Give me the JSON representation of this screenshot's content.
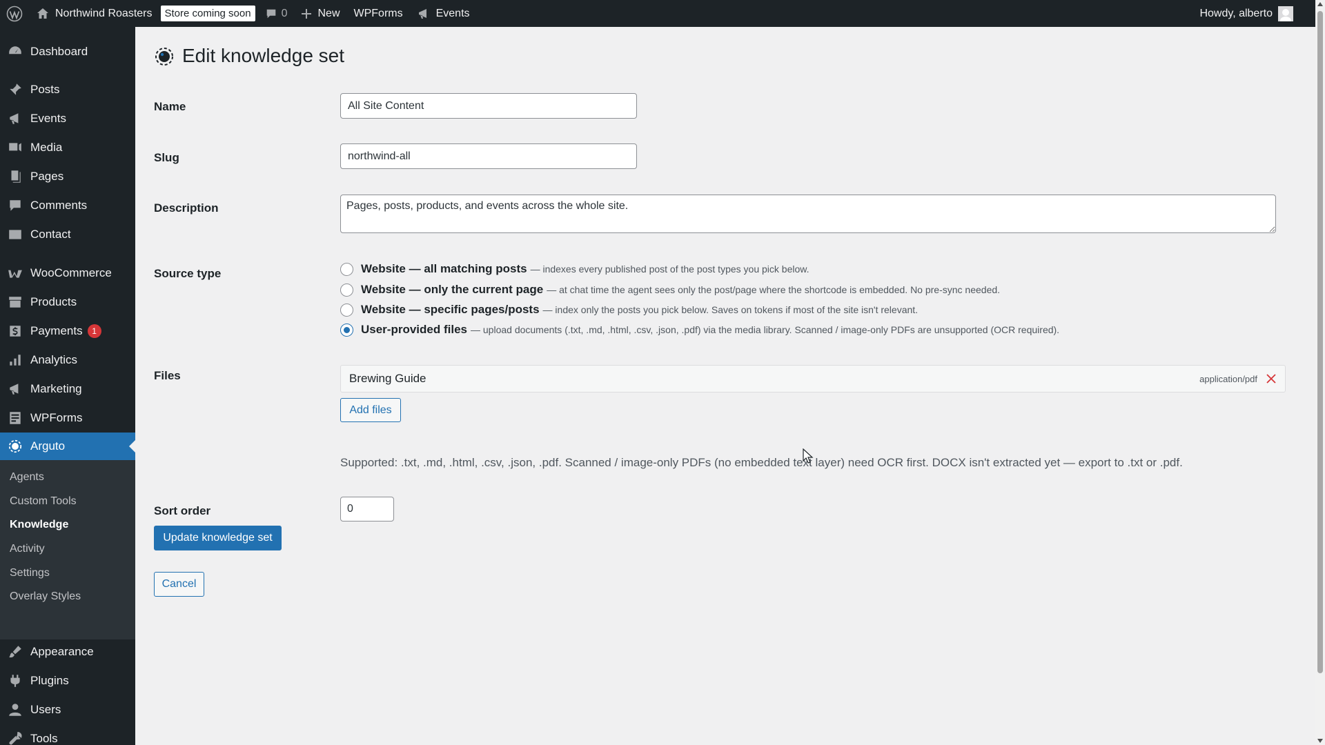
{
  "admin_bar": {
    "site_name": "Northwind Roasters",
    "store_badge": "Store coming soon",
    "comments_count": "0",
    "new_label": "New",
    "wpforms_label": "WPForms",
    "events_label": "Events",
    "greeting": "Howdy, alberto"
  },
  "sidebar": {
    "items": [
      {
        "label": "Dashboard",
        "icon": "dashboard-icon"
      },
      {
        "label": "Posts",
        "icon": "pin-icon"
      },
      {
        "label": "Events",
        "icon": "megaphone-icon"
      },
      {
        "label": "Media",
        "icon": "media-icon"
      },
      {
        "label": "Pages",
        "icon": "pages-icon"
      },
      {
        "label": "Comments",
        "icon": "comment-icon"
      },
      {
        "label": "Contact",
        "icon": "mail-icon"
      },
      {
        "label": "WooCommerce",
        "icon": "woo-icon"
      },
      {
        "label": "Products",
        "icon": "archive-icon"
      },
      {
        "label": "Payments",
        "icon": "dollar-icon",
        "badge": "1"
      },
      {
        "label": "Analytics",
        "icon": "chart-icon"
      },
      {
        "label": "Marketing",
        "icon": "megaphone-icon"
      },
      {
        "label": "WPForms",
        "icon": "form-icon"
      },
      {
        "label": "Arguto",
        "icon": "arguto-icon"
      },
      {
        "label": "Appearance",
        "icon": "brush-icon"
      },
      {
        "label": "Plugins",
        "icon": "plug-icon"
      },
      {
        "label": "Users",
        "icon": "user-icon"
      },
      {
        "label": "Tools",
        "icon": "wrench-icon"
      }
    ],
    "submenu": [
      "Agents",
      "Custom Tools",
      "Knowledge",
      "Activity",
      "Settings",
      "Overlay Styles"
    ],
    "current_submenu": "Knowledge"
  },
  "page": {
    "title": "Edit knowledge set",
    "name_label": "Name",
    "name_value": "All Site Content",
    "slug_label": "Slug",
    "slug_value": "northwind-all",
    "description_label": "Description",
    "description_value": "Pages, posts, products, and events across the whole site.",
    "source_type_label": "Source type",
    "source_options": [
      {
        "title": "Website — all matching posts",
        "desc": "— indexes every published post of the post types you pick below.",
        "checked": false
      },
      {
        "title": "Website — only the current page",
        "desc": "— at chat time the agent sees only the post/page where the shortcode is embedded. No pre-sync needed.",
        "checked": false
      },
      {
        "title": "Website — specific pages/posts",
        "desc": "— index only the posts you pick below. Saves on tokens if most of the site isn't relevant.",
        "checked": false
      },
      {
        "title": "User-provided files",
        "desc": "— upload documents (.txt, .md, .html, .csv, .json, .pdf) via the media library. Scanned / image-only PDFs are unsupported (OCR required).",
        "checked": true
      }
    ],
    "files_label": "Files",
    "file_name": "Brewing Guide",
    "file_mime": "application/pdf",
    "add_files_label": "Add files",
    "supported_text": "Supported: .txt, .md, .html, .csv, .json, .pdf. Scanned / image-only PDFs (no embedded text layer) need OCR first. DOCX isn't extracted yet — export to .txt or .pdf.",
    "sort_order_label": "Sort order",
    "sort_order_value": "0",
    "update_label": "Update knowledge set",
    "cancel_label": "Cancel"
  },
  "colors": {
    "accent": "#2271b1",
    "admin_bg": "#1d2327",
    "page_bg": "#f0f0f1",
    "badge_red": "#d63638"
  }
}
